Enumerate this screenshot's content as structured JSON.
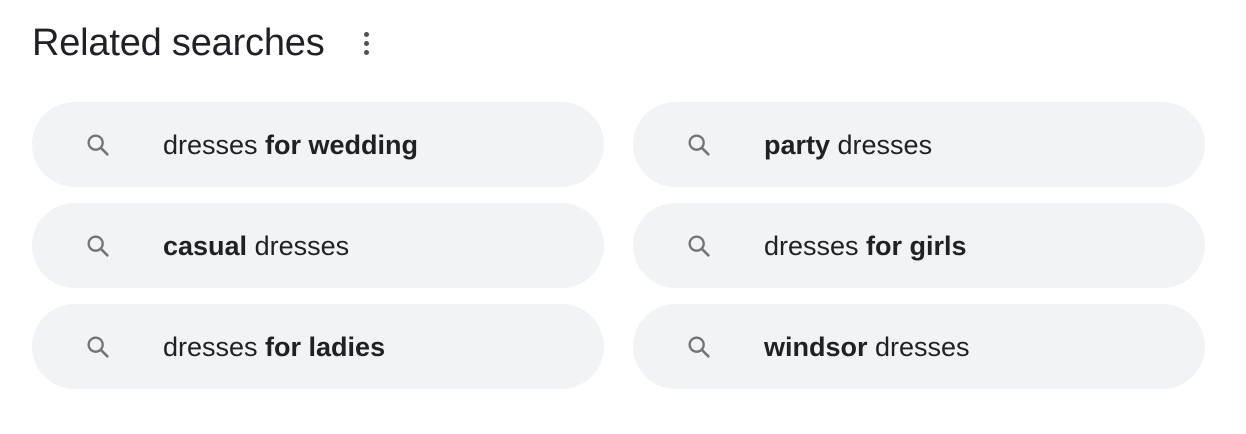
{
  "header": {
    "title": "Related searches",
    "more_icon": "more-vert-icon"
  },
  "colors": {
    "chip_background": "#f1f3f4",
    "text": "#202124",
    "icon": "#70757a"
  },
  "searches": [
    {
      "icon": "search-icon",
      "parts": [
        {
          "text": "dresses ",
          "bold": false
        },
        {
          "text": "for wedding",
          "bold": true
        }
      ]
    },
    {
      "icon": "search-icon",
      "parts": [
        {
          "text": "party",
          "bold": true
        },
        {
          "text": " dresses",
          "bold": false
        }
      ]
    },
    {
      "icon": "search-icon",
      "parts": [
        {
          "text": "casual",
          "bold": true
        },
        {
          "text": " dresses",
          "bold": false
        }
      ]
    },
    {
      "icon": "search-icon",
      "parts": [
        {
          "text": "dresses ",
          "bold": false
        },
        {
          "text": "for girls",
          "bold": true
        }
      ]
    },
    {
      "icon": "search-icon",
      "parts": [
        {
          "text": "dresses ",
          "bold": false
        },
        {
          "text": "for ladies",
          "bold": true
        }
      ]
    },
    {
      "icon": "search-icon",
      "parts": [
        {
          "text": "windsor",
          "bold": true
        },
        {
          "text": " dresses",
          "bold": false
        }
      ]
    }
  ]
}
